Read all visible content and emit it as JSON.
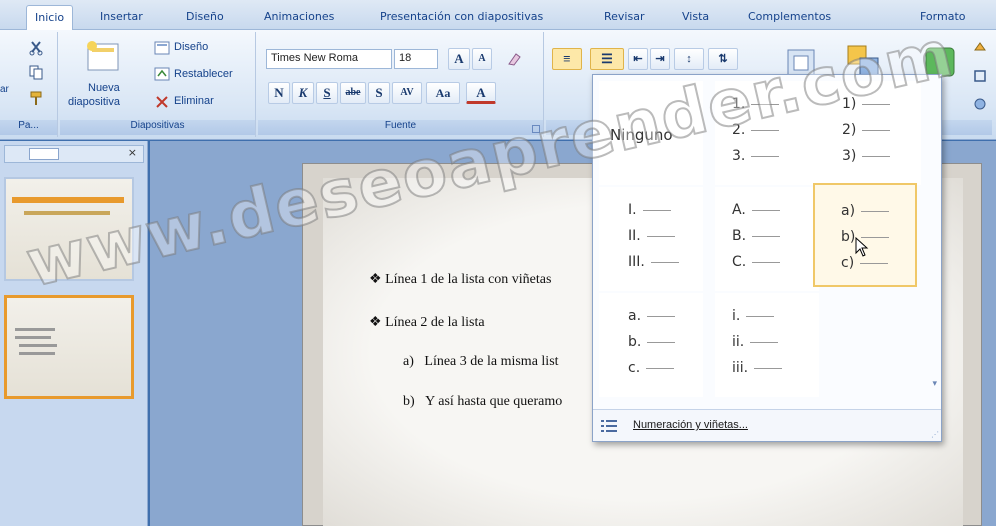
{
  "tabs": [
    "Inicio",
    "Insertar",
    "Diseño",
    "Animaciones",
    "Presentación con diapositivas",
    "Revisar",
    "Vista",
    "Complementos",
    "Formato"
  ],
  "ribbon": {
    "slides_group": {
      "label": "Diapositivas",
      "new_slide_line1": "Nueva",
      "new_slide_line2": "diapositiva",
      "layout": "Diseño",
      "reset": "Restablecer",
      "delete": "Eliminar"
    },
    "clipboard_group": {
      "label": "Pa..."
    },
    "font_group": {
      "label": "Fuente",
      "font_name": "Times New Roma",
      "font_size": "18",
      "bold": "N",
      "italic": "K",
      "underline": "S",
      "strike": "abe",
      "shadow": "S",
      "spacing": "AV",
      "case": "Aa",
      "color": "A"
    }
  },
  "slide": {
    "line1": "Línea 1 de la lista con viñetas",
    "line2": "Línea 2 de la lista",
    "line3_marker": "a)",
    "line3": "Línea 3 de la misma list",
    "line4_marker": "b)",
    "line4": "Y así hasta que queramo"
  },
  "gallery": {
    "none_label": "Ninguno",
    "items": [
      {
        "markers": [
          "1.",
          "2.",
          "3."
        ]
      },
      {
        "markers": [
          "1)",
          "2)",
          "3)"
        ]
      },
      {
        "markers": [
          "I.",
          "II.",
          "III."
        ]
      },
      {
        "markers": [
          "A.",
          "B.",
          "C."
        ]
      },
      {
        "markers": [
          "a)",
          "b)",
          "c)"
        ]
      },
      {
        "markers": [
          "a.",
          "b.",
          "c."
        ]
      },
      {
        "markers": [
          "i.",
          "ii.",
          "iii."
        ]
      }
    ],
    "footer_label": "Numeración y viñetas..."
  },
  "watermark": "www.deseoaprender.com",
  "colors": {
    "accent": "#e89a2d",
    "ribbon_text": "#15428b",
    "hover": "#f0c868"
  }
}
